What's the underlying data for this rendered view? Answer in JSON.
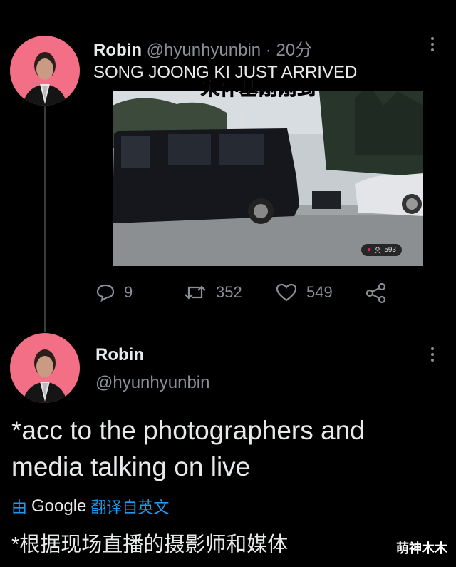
{
  "tweet1": {
    "display_name": "Robin",
    "handle": "@hyunhyunbin",
    "time_sep": "·",
    "time": "20分",
    "text": "SONG JOONG KI JUST ARRIVED",
    "media_overlay_text": "宋仲基刚刚到",
    "media_views": "593",
    "actions": {
      "reply_count": "9",
      "retweet_count": "352",
      "like_count": "549"
    }
  },
  "tweet2": {
    "display_name": "Robin",
    "handle": "@hyunhyunbin",
    "text": "*acc to the photographers and media talking on live",
    "translate": {
      "prefix": "由",
      "provider": "Google",
      "suffix": "翻译自英文"
    },
    "translated_text": "*根据现场直播的摄影师和媒体"
  },
  "watermark": "萌神木木",
  "colors": {
    "background": "#000000",
    "avatar_bg": "#f26f86",
    "link_blue": "#1d9bf0",
    "muted": "#8b9096"
  }
}
